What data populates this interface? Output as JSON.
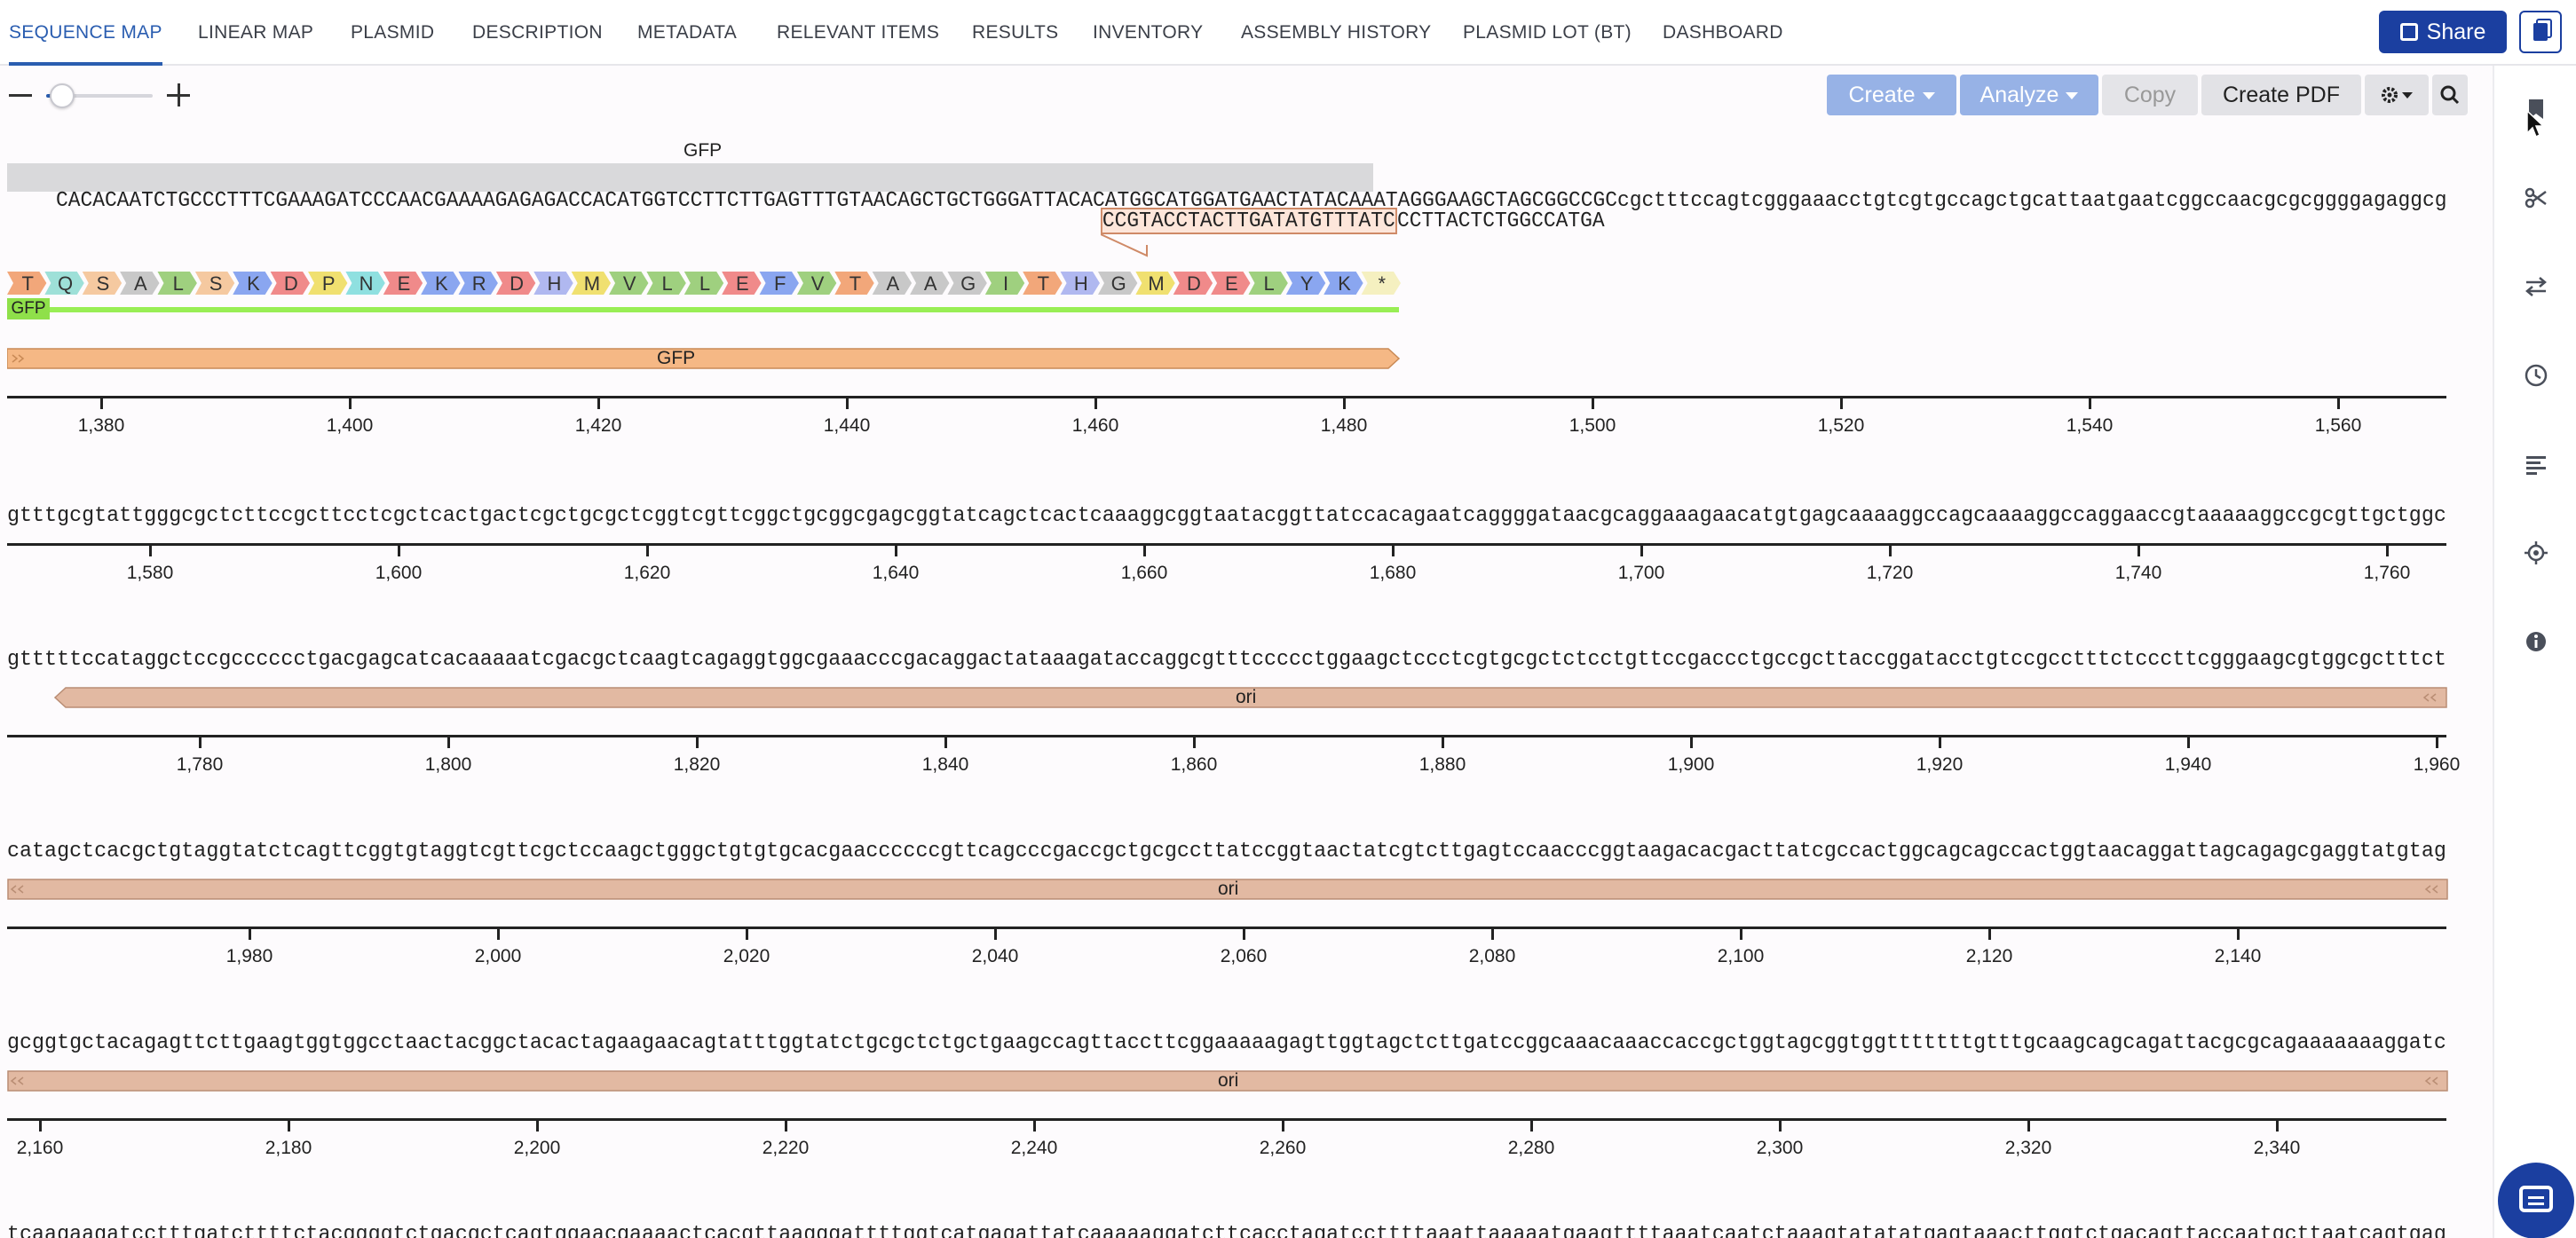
{
  "tabs": [
    {
      "label": "SEQUENCE MAP",
      "active": true
    },
    {
      "label": "LINEAR MAP"
    },
    {
      "label": "PLASMID"
    },
    {
      "label": "DESCRIPTION"
    },
    {
      "label": "METADATA"
    },
    {
      "label": "RELEVANT ITEMS"
    },
    {
      "label": "RESULTS"
    },
    {
      "label": "INVENTORY"
    },
    {
      "label": "ASSEMBLY HISTORY"
    },
    {
      "label": "PLASMID LOT (BT)"
    },
    {
      "label": "DASHBOARD"
    }
  ],
  "header": {
    "share_label": "Share"
  },
  "toolbar": {
    "create_label": "Create",
    "analyze_label": "Analyze",
    "copy_label": "Copy",
    "pdf_label": "Create PDF",
    "zoom_level": 0.15
  },
  "sidebar_icons": [
    "bookmark-icon",
    "scissors-icon",
    "swap-icon",
    "history-icon",
    "align-icon",
    "target-icon",
    "info-icon"
  ],
  "colors": {
    "accent": "#1b3fa0",
    "tab_active": "#2a5db0",
    "gfp_feature": "#f5b885",
    "ori_feature": "#e2b9a2",
    "translation_bar": "#99ee55"
  },
  "sequence": {
    "rows": [
      {
        "gfp_label": "GFP",
        "bases_upper": "CACACAATCTGCCCTTTCGAAAGATCCCAACGAAAAGAGAGACCACATGGTCCTTCTTGAGTTTGTAACAGCTGCTGGGATTACACATGGCATGGATGAACTATACAAATAG",
        "bases_rest": "GGAAGCTAGCGGCCGCcgctttccagtcgggaaacctgtcgtgccagctgcattaatgaatcggccaacgcgcggggagaggcg",
        "primer_bound": "CCGTACCTACTTGATATGTTTATC",
        "primer_tail": "CCTTACTCTGGCCATGA",
        "translation_label": "GFP",
        "amino_acids": [
          "T",
          "Q",
          "S",
          "A",
          "L",
          "S",
          "K",
          "D",
          "P",
          "N",
          "E",
          "K",
          "R",
          "D",
          "H",
          "M",
          "V",
          "L",
          "L",
          "E",
          "F",
          "V",
          "T",
          "A",
          "A",
          "G",
          "I",
          "T",
          "H",
          "G",
          "M",
          "D",
          "E",
          "L",
          "Y",
          "K",
          "*"
        ],
        "feature_label": "GFP",
        "ticks": [
          "1,380",
          "1,400",
          "1,420",
          "1,440",
          "1,460",
          "1,480",
          "1,500",
          "1,520",
          "1,540",
          "1,560"
        ]
      },
      {
        "bases": "gtttgcgtattgggcgctcttccgcttcctcgctcactgactcgctgcgctcggtcgttcggctgcggcgagcggtatcagctcactcaaaggcggtaatacggttatccacagaatcaggggataacgcaggaaagaacatgtgagcaaaaggccagcaaaaggccaggaaccgtaaaaaggccgcgttgctggc",
        "ticks": [
          "1,580",
          "1,600",
          "1,620",
          "1,640",
          "1,660",
          "1,680",
          "1,700",
          "1,720",
          "1,740",
          "1,760"
        ]
      },
      {
        "bases": "gtttttccataggctccgcccccctgacgagcatcacaaaaatcgacgctcaagtcagaggtggcgaaacccgacaggactataaagataccaggcgtttccccctggaagctccctcgtgcgctctcctgttccgaccctgccgcttaccggatacctgtccgcctttctcccttcgggaagcgtggcgctttct",
        "feature_label": "ori",
        "ticks": [
          "1,780",
          "1,800",
          "1,820",
          "1,840",
          "1,860",
          "1,880",
          "1,900",
          "1,920",
          "1,940",
          "1,960"
        ]
      },
      {
        "bases": "catagctcacgctgtaggtatctcagttcggtgtaggtcgttcgctccaagctgggctgtgtgcacgaaccccccgttcagcccgaccgctgcgccttatccggtaactatcgtcttgagtccaacccggtaagacacgacttatcgccactggcagcagccactggtaacaggattagcagagcgaggtatgtag",
        "feature_label": "ori",
        "ticks": [
          "1,980",
          "2,000",
          "2,020",
          "2,040",
          "2,060",
          "2,080",
          "2,100",
          "2,120",
          "2,140"
        ]
      },
      {
        "bases": "gcggtgctacagagttcttgaagtggtggcctaactacggctacactagaagaacagtatttggtatctgcgctctgctgaagccagttaccttcggaaaaagagttggtagctcttgatccggcaaacaaaccaccgctggtagcggtggtttttttgtttgcaagcagcagattacgcgcagaaaaaaaggatc",
        "feature_label": "ori",
        "ticks": [
          "2,160",
          "2,180",
          "2,200",
          "2,220",
          "2,240",
          "2,260",
          "2,280",
          "2,300",
          "2,320",
          "2,340"
        ]
      },
      {
        "bases": "tcaagaagatcctttgatcttttctacggggtctgacgctcagtggaacgaaaactcacgttaagggattttggtcatgagattatcaaaaaggatcttcacctagatccttttaaattaaaaatgaagttttaaatcaatctaaagtatatatgagtaaacttggtctgacagttaccaatgcttaatcagtgag"
      }
    ]
  }
}
